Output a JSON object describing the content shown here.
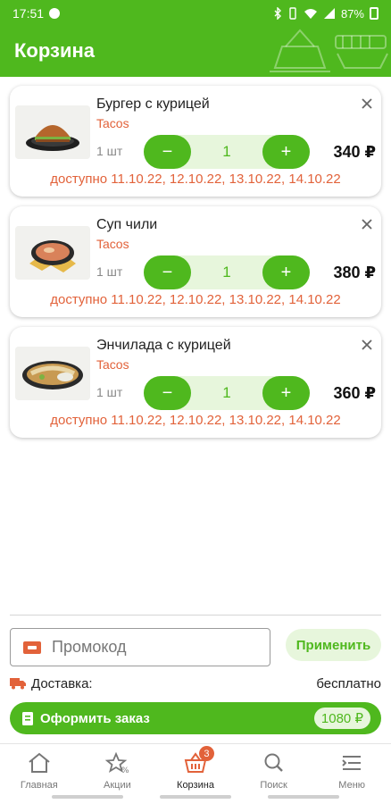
{
  "status_bar": {
    "time": "17:51",
    "battery": "87%"
  },
  "app_bar": {
    "title": "Корзина"
  },
  "cart_items": [
    {
      "name": "Бургер с курицей",
      "store": "Tacos",
      "unit": "1 шт",
      "quantity": "1",
      "price": "340 ₽",
      "availability": "доступно 11.10.22, 12.10.22, 13.10.22, 14.10.22",
      "image": "burger"
    },
    {
      "name": "Суп чили",
      "store": "Tacos",
      "unit": "1 шт",
      "quantity": "1",
      "price": "380 ₽",
      "availability": "доступно 11.10.22, 12.10.22, 13.10.22, 14.10.22",
      "image": "soup"
    },
    {
      "name": "Энчилада с курицей",
      "store": "Tacos",
      "unit": "1 шт",
      "quantity": "1",
      "price": "360 ₽",
      "availability": "доступно 11.10.22, 12.10.22, 13.10.22, 14.10.22",
      "image": "enchilada"
    }
  ],
  "stepper": {
    "minus": "−",
    "plus": "+"
  },
  "promo": {
    "placeholder": "Промокод",
    "apply_label": "Применить"
  },
  "delivery": {
    "label": "Доставка:",
    "value": "бесплатно"
  },
  "checkout": {
    "label": "Оформить заказ",
    "total": "1080 ₽"
  },
  "nav": {
    "items": [
      {
        "label": "Главная",
        "icon": "home-icon"
      },
      {
        "label": "Акции",
        "icon": "star-percent-icon"
      },
      {
        "label": "Корзина",
        "icon": "basket-icon",
        "badge": "3",
        "active": true
      },
      {
        "label": "Поиск",
        "icon": "search-icon"
      },
      {
        "label": "Меню",
        "icon": "menu-icon"
      }
    ]
  },
  "colors": {
    "accent": "#4fb81e",
    "accent_light": "#e7f6dc",
    "warning": "#e2623a"
  }
}
